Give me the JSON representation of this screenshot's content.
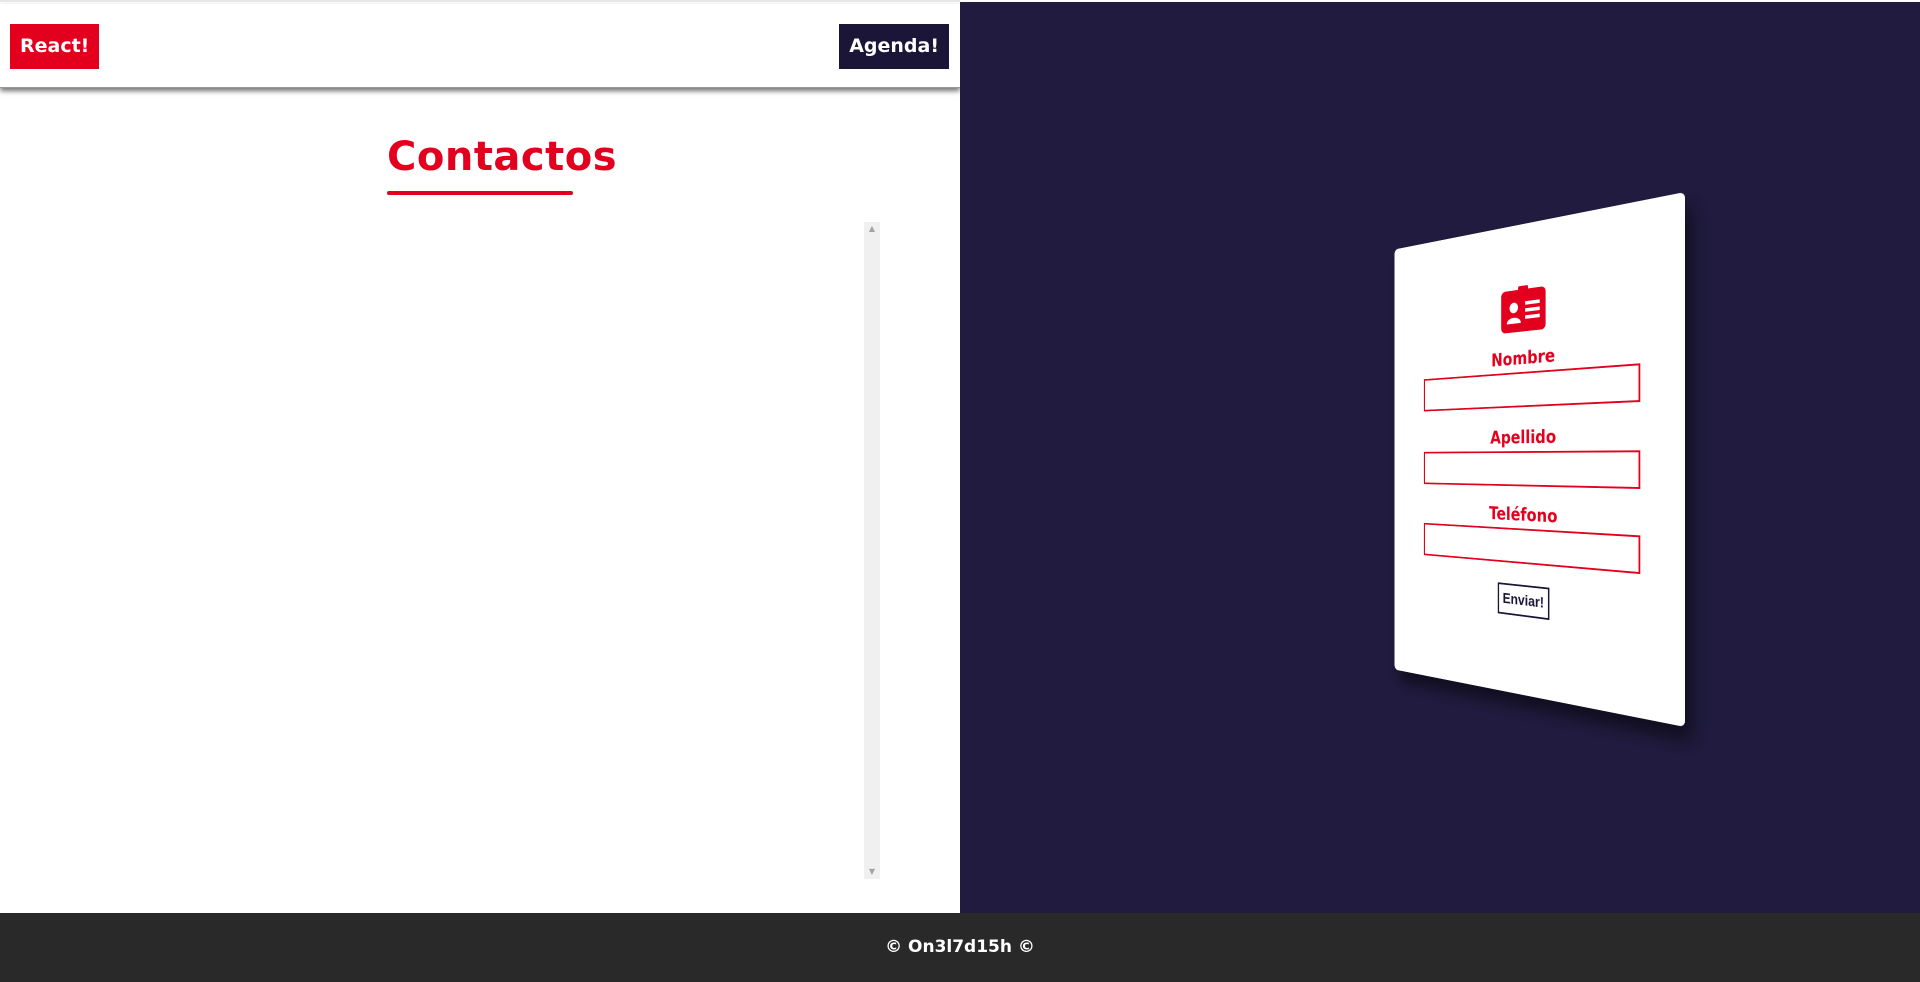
{
  "navbar": {
    "brand_label": "React!",
    "agenda_label": "Agenda!"
  },
  "contacts": {
    "title": "Contactos",
    "scroll_up": "▲",
    "scroll_down": "▼"
  },
  "form": {
    "nombre_label": "Nombre",
    "apellido_label": "Apellido",
    "telefono_label": "Teléfono",
    "nombre_value": "",
    "apellido_value": "",
    "telefono_value": "",
    "submit_label": "Enviar!",
    "icon": "id-card-icon"
  },
  "footer": {
    "text": "© On3l7d15h ©"
  },
  "colors": {
    "accent": "#e3001e",
    "dark": "#201b3f",
    "navy": "#1b1538",
    "footer": "#292929"
  }
}
